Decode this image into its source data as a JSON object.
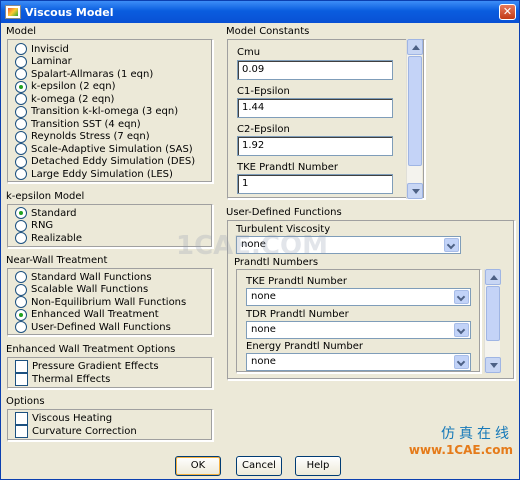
{
  "window": {
    "title": "Viscous Model"
  },
  "model": {
    "label": "Model",
    "options": [
      "Inviscid",
      "Laminar",
      "Spalart-Allmaras (1 eqn)",
      "k-epsilon (2 eqn)",
      "k-omega (2 eqn)",
      "Transition k-kl-omega (3 eqn)",
      "Transition SST (4 eqn)",
      "Reynolds Stress (7 eqn)",
      "Scale-Adaptive Simulation (SAS)",
      "Detached Eddy Simulation (DES)",
      "Large Eddy Simulation (LES)"
    ],
    "selected": "k-epsilon (2 eqn)"
  },
  "kepsilon_model": {
    "label": "k-epsilon Model",
    "options": [
      "Standard",
      "RNG",
      "Realizable"
    ],
    "selected": "Standard"
  },
  "near_wall": {
    "label": "Near-Wall Treatment",
    "options": [
      "Standard Wall Functions",
      "Scalable Wall Functions",
      "Non-Equilibrium Wall Functions",
      "Enhanced Wall Treatment",
      "User-Defined Wall Functions"
    ],
    "selected": "Enhanced Wall Treatment"
  },
  "enhanced_wall": {
    "label": "Enhanced Wall Treatment Options",
    "options": [
      "Pressure Gradient Effects",
      "Thermal Effects"
    ],
    "checked": [
      false,
      false
    ]
  },
  "options": {
    "label": "Options",
    "items": [
      "Viscous Heating",
      "Curvature Correction"
    ],
    "checked": [
      false,
      false
    ]
  },
  "model_constants": {
    "label": "Model Constants",
    "fields": [
      {
        "label": "Cmu",
        "value": "0.09"
      },
      {
        "label": "C1-Epsilon",
        "value": "1.44"
      },
      {
        "label": "C2-Epsilon",
        "value": "1.92"
      },
      {
        "label": "TKE Prandtl Number",
        "value": "1"
      }
    ]
  },
  "udf": {
    "label": "User-Defined Functions",
    "turbulent_viscosity": {
      "label": "Turbulent Viscosity",
      "value": "none"
    },
    "prandtl_numbers": {
      "label": "Prandtl Numbers",
      "fields": [
        {
          "label": "TKE Prandtl Number",
          "value": "none"
        },
        {
          "label": "TDR Prandtl Number",
          "value": "none"
        },
        {
          "label": "Energy Prandtl Number",
          "value": "none"
        }
      ]
    }
  },
  "buttons": {
    "ok": "OK",
    "cancel": "Cancel",
    "help": "Help"
  },
  "watermark": {
    "chinese": "仿真在线",
    "url": "www.1CAE.com",
    "center": "1CAE.COM"
  },
  "colors": {
    "titlebar": "#0a5ddf",
    "dialog_bg": "#ece9d8",
    "radio_dot": "#21a121",
    "watermark_blue": "#1679b9",
    "watermark_orange": "#e57b1a"
  }
}
